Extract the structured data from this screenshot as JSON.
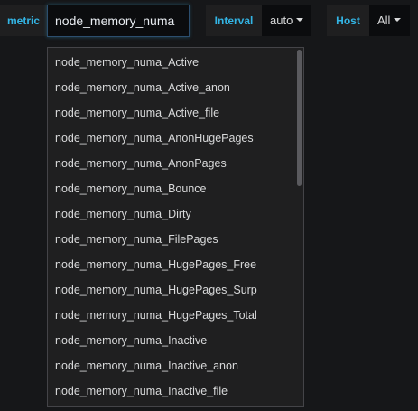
{
  "variables": {
    "metric": {
      "label": "metric",
      "value": "node_memory_numa"
    },
    "interval": {
      "label": "Interval",
      "selected": "auto"
    },
    "host": {
      "label": "Host",
      "selected": "All"
    }
  },
  "menu": {
    "items": [
      "node_memory_numa_Active",
      "node_memory_numa_Active_anon",
      "node_memory_numa_Active_file",
      "node_memory_numa_AnonHugePages",
      "node_memory_numa_AnonPages",
      "node_memory_numa_Bounce",
      "node_memory_numa_Dirty",
      "node_memory_numa_FilePages",
      "node_memory_numa_HugePages_Free",
      "node_memory_numa_HugePages_Surp",
      "node_memory_numa_HugePages_Total",
      "node_memory_numa_Inactive",
      "node_memory_numa_Inactive_anon",
      "node_memory_numa_Inactive_file"
    ]
  },
  "colors": {
    "background": "#161719",
    "label_text": "#33b5e5",
    "label_bg": "#1f1f20",
    "input_bg": "#0b0c0e",
    "text": "#d8d9da"
  },
  "icons": {
    "dropdown": "caret-down-icon"
  }
}
